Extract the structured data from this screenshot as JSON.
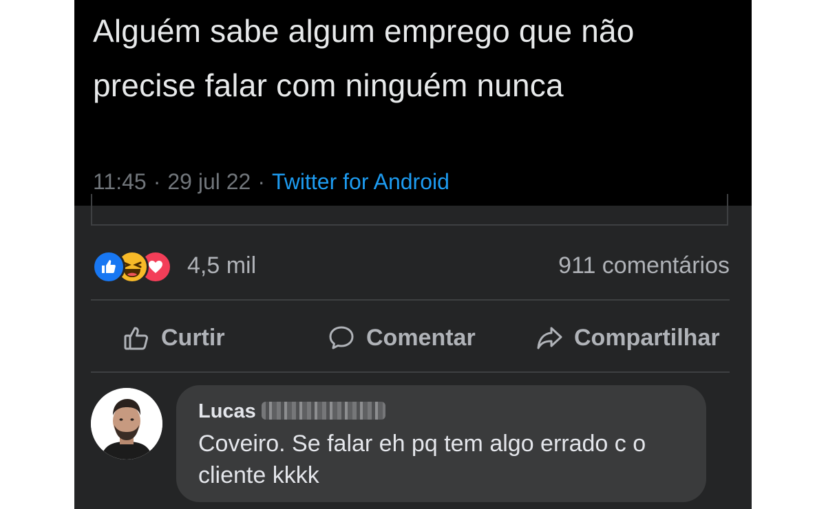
{
  "tweet": {
    "text": "Alguém sabe algum emprego que não precise falar com ninguém nunca",
    "time": "11:45",
    "separator": "·",
    "date": "29 jul 22",
    "source": "Twitter for Android"
  },
  "post": {
    "reactions": [
      "like",
      "haha",
      "love"
    ],
    "reaction_count": "4,5 mil",
    "comment_count": "911 comentários"
  },
  "actions": {
    "like_label": "Curtir",
    "comment_label": "Comentar",
    "share_label": "Compartilhar"
  },
  "comment": {
    "author_first_name": "Lucas",
    "author_redacted": true,
    "text": "Coveiro. Se falar eh pq tem algo errado c o cliente kkkk"
  },
  "colors": {
    "background": "#242526",
    "tweet_background": "#000000",
    "link_blue": "#1d9bf0",
    "like_blue": "#1877f2",
    "haha_yellow": "#f7b928",
    "love_red": "#f33e58",
    "bubble": "#3a3b3c"
  }
}
